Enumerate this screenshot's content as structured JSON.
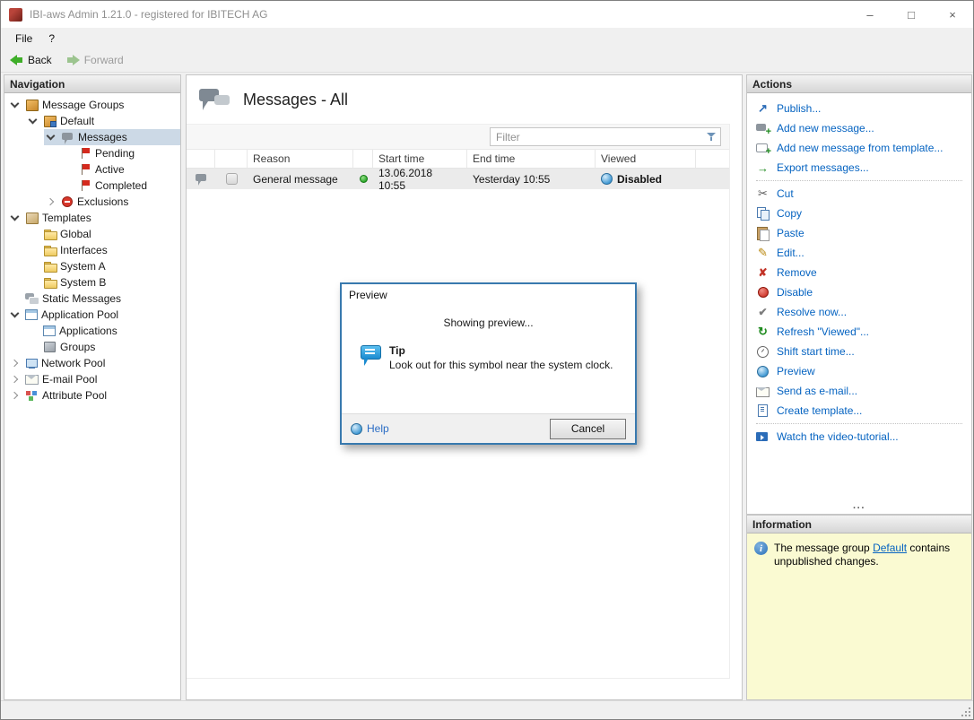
{
  "colors": {
    "action-link": "#0563c1",
    "selection-bg": "#ccd9e6",
    "info-bg": "#fafad2",
    "status-green": "#28a428",
    "dialog-border": "#3879ae",
    "flag-red": "#d42a1e"
  },
  "window": {
    "title": "IBI-aws Admin 1.21.0 - registered for IBITECH AG",
    "minimize": "–",
    "maximize": "□",
    "close": "×"
  },
  "menubar": {
    "file": "File",
    "help": "?"
  },
  "toolbar": {
    "back": "Back",
    "forward": "Forward"
  },
  "navigation": {
    "header": "Navigation",
    "tree": [
      {
        "label": "Message Groups",
        "level": 0,
        "chevron": "down",
        "icon": "group-icon"
      },
      {
        "label": "Default",
        "level": 1,
        "chevron": "down",
        "icon": "default-group-icon"
      },
      {
        "label": "Messages",
        "level": 2,
        "chevron": "down",
        "icon": "messages-icon",
        "state": "selected"
      },
      {
        "label": "Pending",
        "level": 3,
        "chevron": "none",
        "icon": "pending-flag-icon"
      },
      {
        "label": "Active",
        "level": 3,
        "chevron": "none",
        "icon": "active-flag-icon"
      },
      {
        "label": "Completed",
        "level": 3,
        "chevron": "none",
        "icon": "completed-flag-icon"
      },
      {
        "label": "Exclusions",
        "level": 2,
        "chevron": "right",
        "icon": "exclusions-icon"
      },
      {
        "label": "Templates",
        "level": 0,
        "chevron": "down",
        "icon": "templates-icon"
      },
      {
        "label": "Global",
        "level": 1,
        "chevron": "none",
        "icon": "folder-icon"
      },
      {
        "label": "Interfaces",
        "level": 1,
        "chevron": "none",
        "icon": "folder-icon"
      },
      {
        "label": "System A",
        "level": 1,
        "chevron": "none",
        "icon": "folder-icon"
      },
      {
        "label": "System B",
        "level": 1,
        "chevron": "none",
        "icon": "folder-icon"
      },
      {
        "label": "Static Messages",
        "level": 0,
        "chevron": "none",
        "icon": "static-messages-icon"
      },
      {
        "label": "Application Pool",
        "level": 0,
        "chevron": "down",
        "icon": "application-pool-icon"
      },
      {
        "label": "Applications",
        "level": 1,
        "chevron": "none",
        "icon": "applications-icon"
      },
      {
        "label": "Groups",
        "level": 1,
        "chevron": "none",
        "icon": "groups-icon"
      },
      {
        "label": "Network Pool",
        "level": 0,
        "chevron": "right",
        "icon": "network-pool-icon"
      },
      {
        "label": "E-mail Pool",
        "level": 0,
        "chevron": "right",
        "icon": "email-pool-icon"
      },
      {
        "label": "Attribute Pool",
        "level": 0,
        "chevron": "right",
        "icon": "attribute-pool-icon"
      }
    ]
  },
  "main": {
    "title": "Messages - All",
    "filter_placeholder": "Filter",
    "columns": {
      "reason": "Reason",
      "start": "Start time",
      "end": "End time",
      "viewed": "Viewed"
    },
    "rows": [
      {
        "reason": "General message",
        "start": "13.06.2018 10:55",
        "end": "Yesterday 10:55",
        "viewed": "Disabled"
      }
    ]
  },
  "dialog": {
    "title": "Preview",
    "message": "Showing preview...",
    "tip_title": "Tip",
    "tip_text": "Look out for this symbol near the system clock.",
    "help": "Help",
    "cancel": "Cancel"
  },
  "actions": {
    "header": "Actions",
    "overflow": "···",
    "items": [
      {
        "label": "Publish...",
        "icon": "publish-icon"
      },
      {
        "label": "Add new message...",
        "icon": "add-message-icon"
      },
      {
        "label": "Add new message from template...",
        "icon": "add-from-template-icon"
      },
      {
        "label": "Export messages...",
        "icon": "export-icon",
        "sep": true
      },
      {
        "label": "Cut",
        "icon": "cut-icon"
      },
      {
        "label": "Copy",
        "icon": "copy-icon"
      },
      {
        "label": "Paste",
        "icon": "paste-icon"
      },
      {
        "label": "Edit...",
        "icon": "edit-icon"
      },
      {
        "label": "Remove",
        "icon": "remove-icon"
      },
      {
        "label": "Disable",
        "icon": "disable-icon"
      },
      {
        "label": "Resolve now...",
        "icon": "resolve-icon"
      },
      {
        "label": "Refresh \"Viewed\"...",
        "icon": "refresh-icon"
      },
      {
        "label": "Shift start time...",
        "icon": "shift-time-icon"
      },
      {
        "label": "Preview",
        "icon": "preview-icon"
      },
      {
        "label": "Send as e-mail...",
        "icon": "send-email-icon"
      },
      {
        "label": "Create template...",
        "icon": "create-template-icon",
        "sep": true
      },
      {
        "label": "Watch the video-tutorial...",
        "icon": "video-icon"
      }
    ]
  },
  "information": {
    "header": "Information",
    "text_before": "The message group ",
    "link": "Default",
    "text_after": " contains unpublished changes."
  }
}
